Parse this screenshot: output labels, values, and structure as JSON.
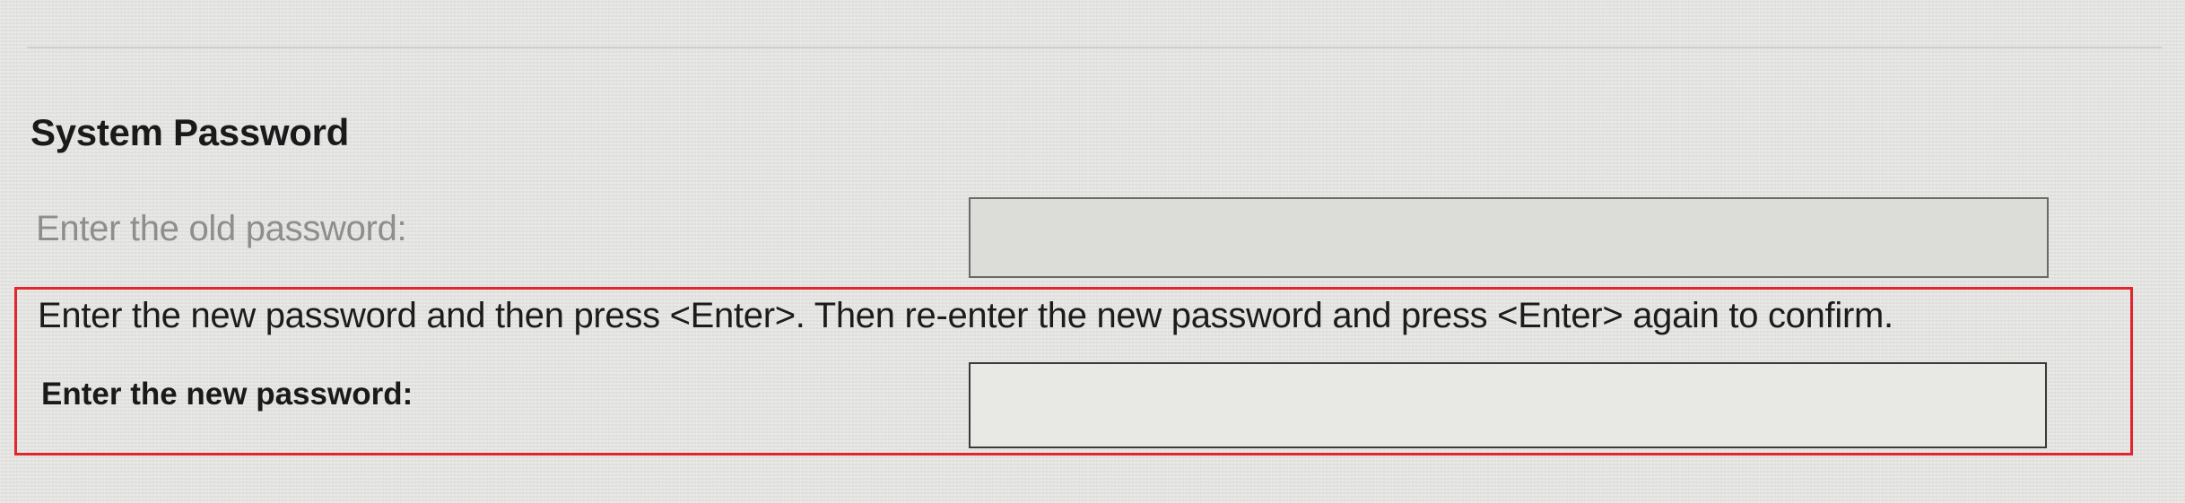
{
  "section": {
    "title": "System Password"
  },
  "old_password": {
    "label": "Enter the old password:",
    "value": ""
  },
  "instruction": "Enter the new password and then press <Enter>. Then re-enter the new password and press <Enter> again to confirm.",
  "new_password": {
    "label": "Enter the new password:",
    "value": ""
  },
  "colors": {
    "highlight": "#e3262e",
    "background": "#e6e6e3",
    "disabled_text": "#8e8e8c"
  }
}
